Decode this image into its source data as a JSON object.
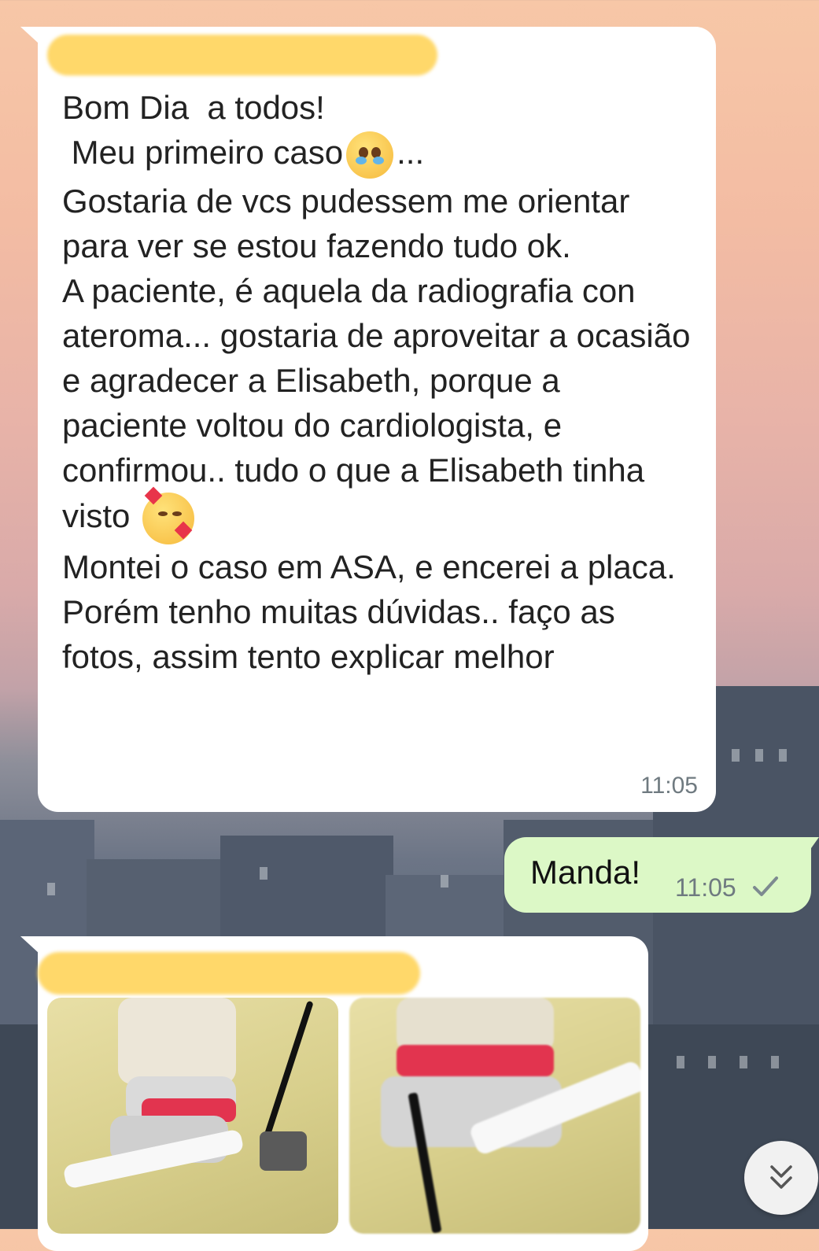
{
  "messages": [
    {
      "direction": "incoming",
      "lines": [
        "Bom Dia  a todos!",
        " Meu primeiro caso",
        "...",
        "Gostaria de vcs pudessem me orientar para ver se estou fazendo tudo ok.",
        "A paciente, é aquela da radiografia con ateroma... gostaria de aproveitar a ocasião e agradecer a Elisabeth, porque a paciente voltou do cardiologista, e confirmou.. tudo o que a Elisabeth tinha visto",
        "Montei o caso em ASA, e encerei a placa. Porém tenho muitas dúvidas.. faço as fotos, assim tento explicar melhor"
      ],
      "time": "11:05"
    },
    {
      "direction": "outgoing",
      "text": "Manda!",
      "time": "11:05"
    }
  ],
  "icons": {
    "pleading_face": "pleading-face-emoji",
    "smiling_hearts": "smiling-face-with-hearts-emoji",
    "sent_check": "single-check-icon",
    "scroll_down": "double-chevron-down-icon"
  },
  "colors": {
    "incoming_bubble": "#ffffff",
    "outgoing_bubble": "#dcf8c6",
    "redacted_name": "#ffd86a",
    "timestamp": "#6f7a80"
  }
}
